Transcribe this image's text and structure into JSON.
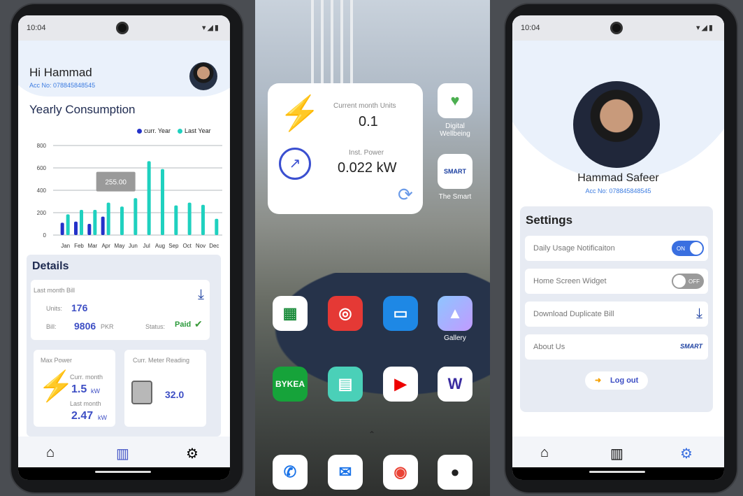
{
  "left": {
    "time": "10:04",
    "greeting": "Hi Hammad",
    "acc": "Acc No: 078845848545",
    "yearly_title": "Yearly Consumption",
    "legend": {
      "current": "curr. Year",
      "last": "Last Year"
    },
    "tooltip": "255.00",
    "details_title": "Details",
    "last_month_label": "Last month Bill",
    "units_label": "Units:",
    "units_value": "176",
    "bill_label": "Bill:",
    "bill_value": "9806",
    "bill_currency": "PKR",
    "status_label": "Status:",
    "status_value": "Paid",
    "max_power_label": "Max Power",
    "curr_month_label": "Curr. month",
    "curr_month_value": "1.5",
    "curr_month_unit": "kW",
    "last_month_label2": "Last month",
    "last_month_value": "2.47",
    "last_month_unit": "kW",
    "meter_label": "Curr. Meter Reading",
    "meter_value": "32.0"
  },
  "chart_data": {
    "type": "bar",
    "categories": [
      "Jan",
      "Feb",
      "Mar",
      "Apr",
      "May",
      "Jun",
      "Jul",
      "Aug",
      "Sep",
      "Oct",
      "Nov",
      "Dec"
    ],
    "series": [
      {
        "name": "curr. Year",
        "values": [
          110,
          120,
          100,
          165,
          null,
          null,
          null,
          null,
          null,
          null,
          null,
          null
        ],
        "color": "#2432c9"
      },
      {
        "name": "Last Year",
        "values": [
          185,
          225,
          225,
          290,
          255,
          330,
          660,
          590,
          265,
          290,
          270,
          145
        ],
        "color": "#1fd1bf"
      }
    ],
    "yticks": [
      0,
      200,
      400,
      600,
      800
    ],
    "ylim": [
      0,
      800
    ]
  },
  "middle": {
    "widget_units_label": "Current month Units",
    "widget_units_value": "0.1",
    "widget_power_label": "Inst. Power",
    "widget_power_value": "0.022 kW",
    "wellbeing_label": "Digital Wellbeing",
    "smart_label": "The Smart",
    "gallery_label": "Gallery",
    "bykea": "BYKEA",
    "smart_logo": "SMART"
  },
  "right": {
    "time": "10:04",
    "name": "Hammad Safeer",
    "acc": "Acc No: 078845848545",
    "settings_title": "Settings",
    "row1": "Daily Usage Notificaiton",
    "row1_toggle": "ON",
    "row2": "Home Screen Widget",
    "row2_toggle": "OFF",
    "row3": "Download Duplicate Bill",
    "row4": "About Us",
    "about_logo": "SMART",
    "logout": "Log out"
  }
}
